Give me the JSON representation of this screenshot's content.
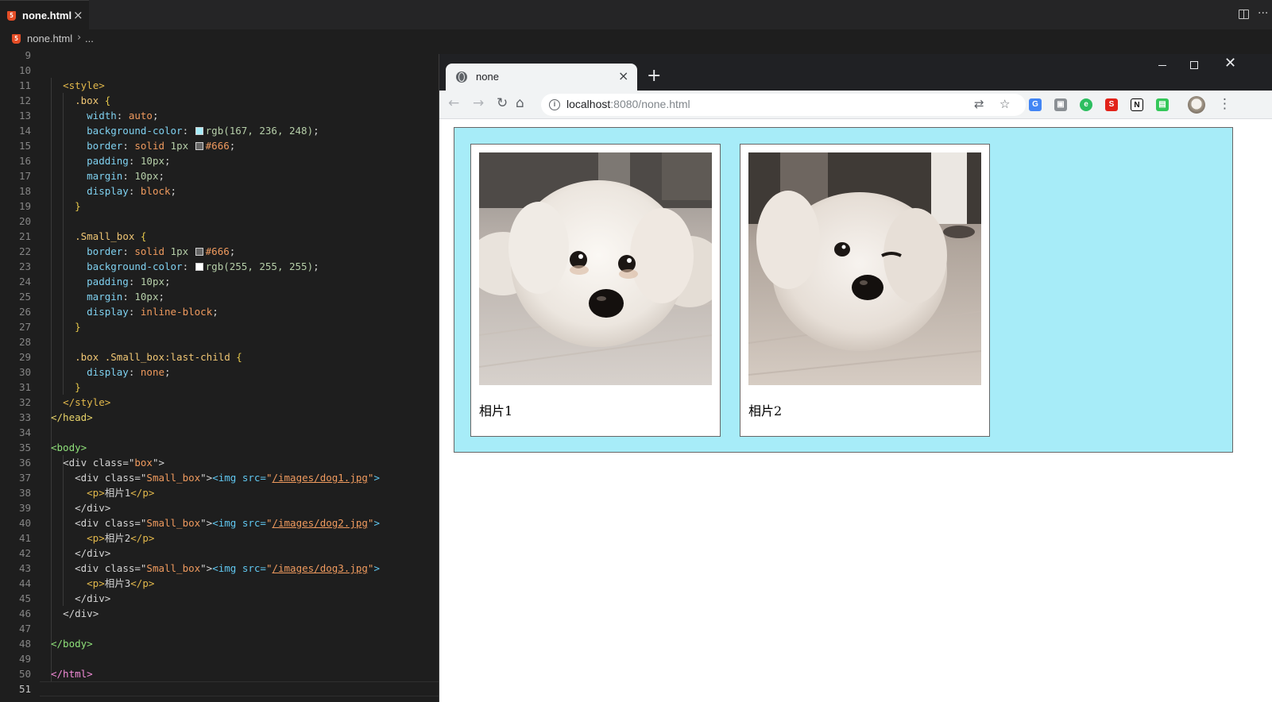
{
  "editor": {
    "tab_label": "none.html",
    "tab_icon": "html5-icon",
    "breadcrumb_file": "none.html",
    "breadcrumb_rest": "...",
    "line_numbers": [
      "9",
      "10",
      "11",
      "12",
      "13",
      "14",
      "15",
      "16",
      "17",
      "18",
      "19",
      "20",
      "21",
      "22",
      "23",
      "24",
      "25",
      "26",
      "27",
      "28",
      "29",
      "30",
      "31",
      "32",
      "33",
      "34",
      "35",
      "36",
      "37",
      "38",
      "39",
      "40",
      "41",
      "42",
      "43",
      "44",
      "45",
      "46",
      "47",
      "48",
      "49",
      "50",
      "51"
    ],
    "css": {
      "box_selector": ".box",
      "box_width": "auto",
      "box_bg": "rgb(167, 236, 248)",
      "box_border": "#666",
      "box_padding": "10px",
      "box_margin": "10px",
      "box_display": "block",
      "small_selector": ".Small_box",
      "small_border": "#666",
      "small_bg": "rgb(255, 255, 255)",
      "small_padding": "10px",
      "small_margin": "10px",
      "small_display": "inline-block",
      "last_selector": ".box .Small_box:last-child",
      "last_display": "none"
    },
    "html": {
      "img1": "/images/dog1.jpg",
      "img2": "/images/dog2.jpg",
      "img3": "/images/dog3.jpg",
      "cap1": "相片1",
      "cap2": "相片2",
      "cap3": "相片3"
    }
  },
  "browser": {
    "tab_title": "none",
    "url_host": "localhost",
    "url_rest": ":8080/none.html",
    "extensions": [
      "translate-icon",
      "star-icon",
      "google-translate-ext",
      "ext-square",
      "evernote-ext",
      "s-ext",
      "notion-ext",
      "shopping-bag-ext"
    ]
  },
  "page": {
    "box_color": "#a7ecf8",
    "items": [
      {
        "caption": "相片1"
      },
      {
        "caption": "相片2"
      }
    ]
  },
  "colors": {
    "editor_bg": "#1e1e1e",
    "chrome_dark": "#202124",
    "chrome_light": "#f1f3f4"
  }
}
